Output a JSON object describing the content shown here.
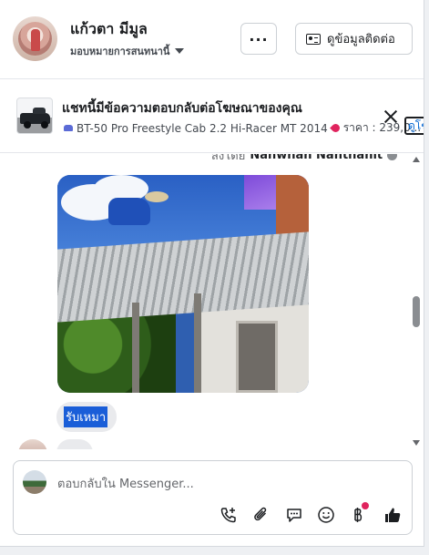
{
  "header": {
    "name": "แก้วตา มีมูล",
    "subtitle": "มอบหมายการสนทนานี้",
    "more_label": "...",
    "contact_label": "ดูข้อมูลติดต่อ"
  },
  "ad": {
    "heading": "แชทนี้มีข้อความตอบกลับต่อโฆษณาของคุณ",
    "product": "BT-50 Pro Freestyle Cab 2.2 Hi-Racer MT 2014",
    "price": "ราคา : 239,0...",
    "view_label": "ดูโฆษ"
  },
  "chat": {
    "sent_by_prefix": "ส่งโดย",
    "sent_by_name": "Nanwhan Nanthanit",
    "message_text": "รับเหมา"
  },
  "composer": {
    "placeholder": "ตอบกลับใน Messenger...",
    "tools": [
      "call-add-icon",
      "attach-icon",
      "chat-bubble-icon",
      "emoji-icon",
      "baht-icon",
      "like-icon"
    ]
  },
  "colors": {
    "accent": "#1a5ed8",
    "like": "#1c1e21",
    "notification": "#e0245e"
  }
}
